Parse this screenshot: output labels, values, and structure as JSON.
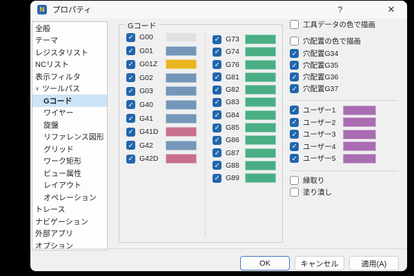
{
  "window": {
    "title": "プロパティ",
    "app_icon_letter": "N",
    "help_label": "?",
    "close_label": "✕"
  },
  "sidebar": {
    "items": [
      {
        "label": "全般",
        "level": 0,
        "selected": false,
        "chevron": false
      },
      {
        "label": "テーマ",
        "level": 0,
        "selected": false,
        "chevron": false
      },
      {
        "label": "レジスタリスト",
        "level": 0,
        "selected": false,
        "chevron": false
      },
      {
        "label": "NCリスト",
        "level": 0,
        "selected": false,
        "chevron": false
      },
      {
        "label": "表示フィルタ",
        "level": 0,
        "selected": false,
        "chevron": false
      },
      {
        "label": "ツールパス",
        "level": 0,
        "selected": false,
        "chevron": true
      },
      {
        "label": "Gコード",
        "level": 1,
        "selected": true,
        "chevron": false
      },
      {
        "label": "ワイヤー",
        "level": 1,
        "selected": false,
        "chevron": false
      },
      {
        "label": "旋盤",
        "level": 1,
        "selected": false,
        "chevron": false
      },
      {
        "label": "リファレンス図形",
        "level": 1,
        "selected": false,
        "chevron": false
      },
      {
        "label": "グリッド",
        "level": 1,
        "selected": false,
        "chevron": false
      },
      {
        "label": "ワーク矩形",
        "level": 1,
        "selected": false,
        "chevron": false
      },
      {
        "label": "ビュー属性",
        "level": 1,
        "selected": false,
        "chevron": false
      },
      {
        "label": "レイアウト",
        "level": 1,
        "selected": false,
        "chevron": false
      },
      {
        "label": "オペレーション",
        "level": 1,
        "selected": false,
        "chevron": false
      },
      {
        "label": "トレース",
        "level": 0,
        "selected": false,
        "chevron": false
      },
      {
        "label": "ナビゲーション",
        "level": 0,
        "selected": false,
        "chevron": false
      },
      {
        "label": "外部アプリ",
        "level": 0,
        "selected": false,
        "chevron": false
      },
      {
        "label": "オプション",
        "level": 0,
        "selected": false,
        "chevron": false
      }
    ]
  },
  "gcode_group": {
    "label": "Gコード",
    "column1": [
      {
        "label": "G00",
        "checked": true,
        "color": "#e1e1e3"
      },
      {
        "label": "G01",
        "checked": true,
        "color": "#7497b9"
      },
      {
        "label": "G01Z",
        "checked": true,
        "color": "#e9b51f"
      },
      {
        "label": "G02",
        "checked": true,
        "color": "#7497b9"
      },
      {
        "label": "G03",
        "checked": true,
        "color": "#7497b9"
      },
      {
        "label": "G40",
        "checked": true,
        "color": "#7497b9"
      },
      {
        "label": "G41",
        "checked": true,
        "color": "#7497b9"
      },
      {
        "label": "G41D",
        "checked": true,
        "color": "#c7708d"
      },
      {
        "label": "G42",
        "checked": true,
        "color": "#7497b9"
      },
      {
        "label": "G42D",
        "checked": true,
        "color": "#c7708d"
      }
    ],
    "column2": [
      {
        "label": "G73",
        "checked": true,
        "color": "#4aae85"
      },
      {
        "label": "G74",
        "checked": true,
        "color": "#4aae85"
      },
      {
        "label": "G76",
        "checked": true,
        "color": "#4aae85"
      },
      {
        "label": "G81",
        "checked": true,
        "color": "#4aae85"
      },
      {
        "label": "G82",
        "checked": true,
        "color": "#4aae85"
      },
      {
        "label": "G83",
        "checked": true,
        "color": "#4aae85"
      },
      {
        "label": "G84",
        "checked": true,
        "color": "#4aae85"
      },
      {
        "label": "G85",
        "checked": true,
        "color": "#4aae85"
      },
      {
        "label": "G86",
        "checked": true,
        "color": "#4aae85"
      },
      {
        "label": "G87",
        "checked": true,
        "color": "#4aae85"
      },
      {
        "label": "G88",
        "checked": true,
        "color": "#4aae85"
      },
      {
        "label": "G89",
        "checked": true,
        "color": "#4aae85"
      }
    ]
  },
  "options": {
    "draw_tool_color": {
      "label": "工具データの色で描画",
      "checked": false
    },
    "draw_hole_color": {
      "label": "穴配置の色で描画",
      "checked": false
    },
    "holes": [
      {
        "label": "穴配置G34",
        "checked": true
      },
      {
        "label": "穴配置G35",
        "checked": true
      },
      {
        "label": "穴配置G36",
        "checked": true
      },
      {
        "label": "穴配置G37",
        "checked": true
      }
    ],
    "users": [
      {
        "label": "ユーザー1",
        "checked": true,
        "color": "#a96db1"
      },
      {
        "label": "ユーザー2",
        "checked": true,
        "color": "#a96db1"
      },
      {
        "label": "ユーザー3",
        "checked": true,
        "color": "#a96db1"
      },
      {
        "label": "ユーザー4",
        "checked": true,
        "color": "#a96db1"
      },
      {
        "label": "ユーザー5",
        "checked": true,
        "color": "#a96db1"
      }
    ],
    "outline": {
      "label": "縁取り",
      "checked": false
    },
    "fill": {
      "label": "塗り潰し",
      "checked": false
    }
  },
  "buttons": {
    "ok": "OK",
    "cancel": "キャンセル",
    "apply": "適用(A)"
  },
  "colors": {
    "accent_checkbox": "#2166ac",
    "selection_bg": "#cce4f7",
    "dialog_bg": "#f0f0f0"
  }
}
